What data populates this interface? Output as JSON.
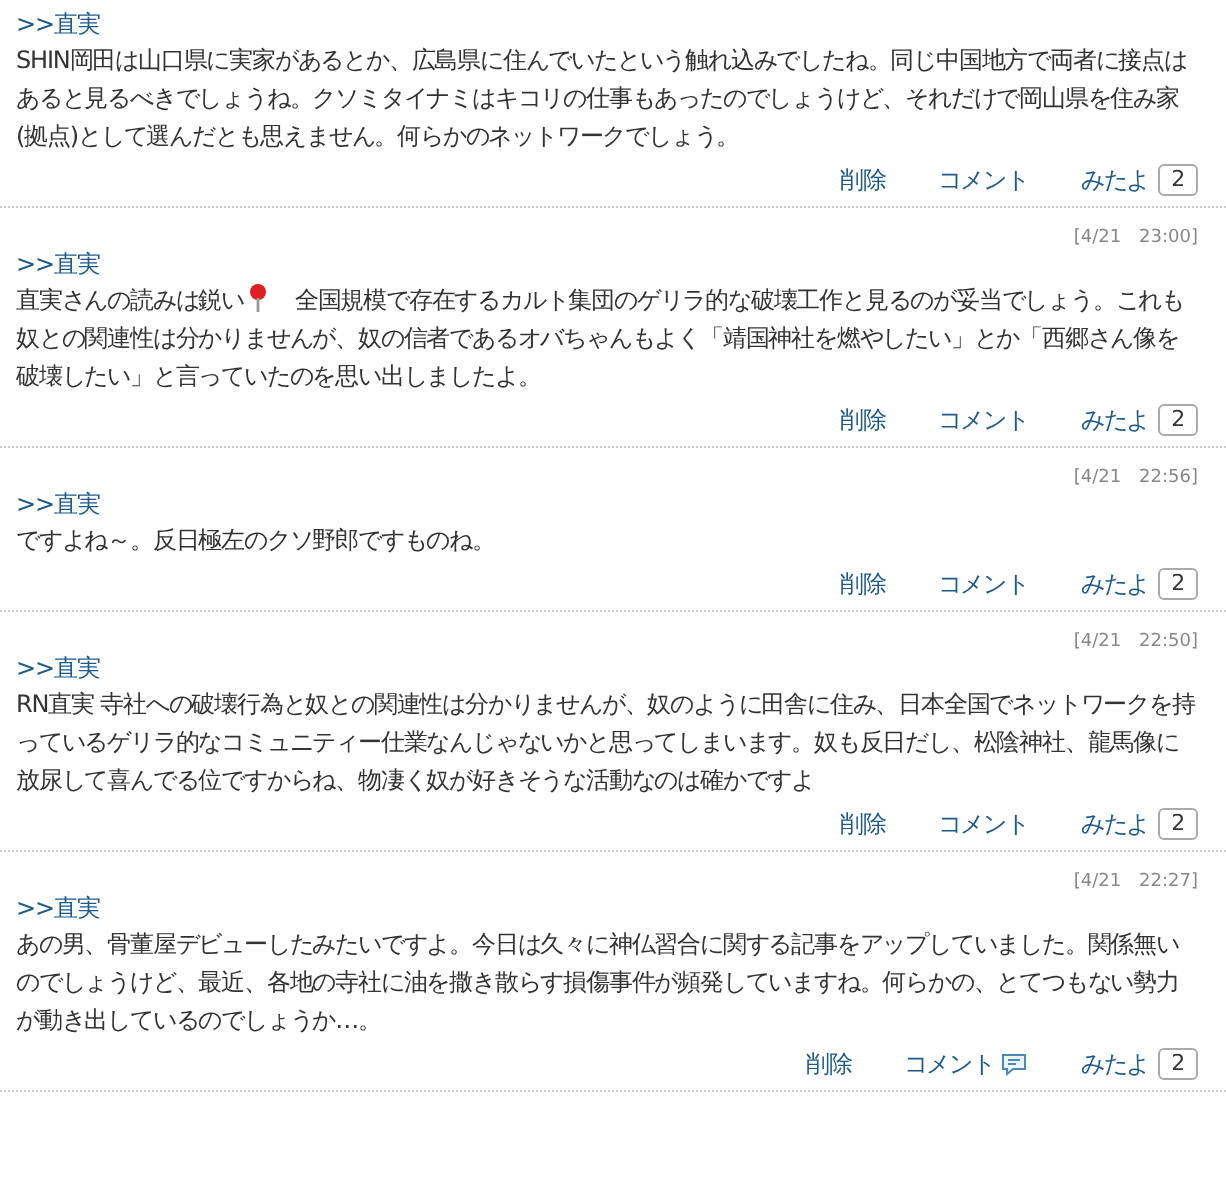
{
  "comments": [
    {
      "author": ">>直実",
      "segments": [
        {
          "kind": "text",
          "text": "SHIN岡田は山口県に実家があるとか、広島県に住んでいたという触れ込みでしたね。同じ中国地方で両者に接点はあると見るべきでしょうね。クソミタイナミはキコリの仕事もあったのでしょうけど、それだけで岡山県を住み家(拠点)として選んだとも思えません。何らかのネットワークでしょう。"
        }
      ],
      "actions": {
        "delete": "削除",
        "comment": "コメント",
        "comment_icon": false,
        "like": "みたよ",
        "count": "2"
      }
    },
    {
      "date": "[4/21　23:00]",
      "author": ">>直実",
      "segments": [
        {
          "kind": "text",
          "text": "直実さんの読みは鋭い"
        },
        {
          "kind": "pin"
        },
        {
          "kind": "text",
          "text": "　全国規模で存在するカルト集団のゲリラ的な破壊工作と見るのが妥当でしょう。これも奴との関連性は分かりませんが、奴の信者であるオバちゃんもよく「靖国神社を燃やしたい」とか「西郷さん像を破壊したい」と言っていたのを思い出しましたよ。"
        }
      ],
      "actions": {
        "delete": "削除",
        "comment": "コメント",
        "comment_icon": false,
        "like": "みたよ",
        "count": "2"
      }
    },
    {
      "date": "[4/21　22:56]",
      "author": ">>直実",
      "segments": [
        {
          "kind": "text",
          "text": "ですよね～。反日極左のクソ野郎ですものね。"
        }
      ],
      "actions": {
        "delete": "削除",
        "comment": "コメント",
        "comment_icon": false,
        "like": "みたよ",
        "count": "2"
      }
    },
    {
      "date": "[4/21　22:50]",
      "author": ">>直実",
      "segments": [
        {
          "kind": "text",
          "text": "RN直実 寺社への破壊行為と奴との関連性は分かりませんが、奴のように田舎に住み、日本全国でネットワークを持っているゲリラ的なコミュニティー仕業なんじゃないかと思ってしまいます。奴も反日だし、松陰神社、龍馬像に放尿して喜んでる位ですからね、物凄く奴が好きそうな活動なのは確かですよ"
        }
      ],
      "actions": {
        "delete": "削除",
        "comment": "コメント",
        "comment_icon": false,
        "like": "みたよ",
        "count": "2"
      }
    },
    {
      "date": "[4/21　22:27]",
      "author": ">>直実",
      "segments": [
        {
          "kind": "text",
          "text": "あの男、骨董屋デビューしたみたいですよ。今日は久々に神仏習合に関する記事をアップしていました。関係無いのでしょうけど、最近、各地の寺社に油を撒き散らす損傷事件が頻発していますね。何らかの、とてつもない勢力が動き出しているのでしょうか…。"
        }
      ],
      "actions": {
        "delete": "削除",
        "comment": "コメント",
        "comment_icon": true,
        "like": "みたよ",
        "count": "2"
      }
    }
  ]
}
